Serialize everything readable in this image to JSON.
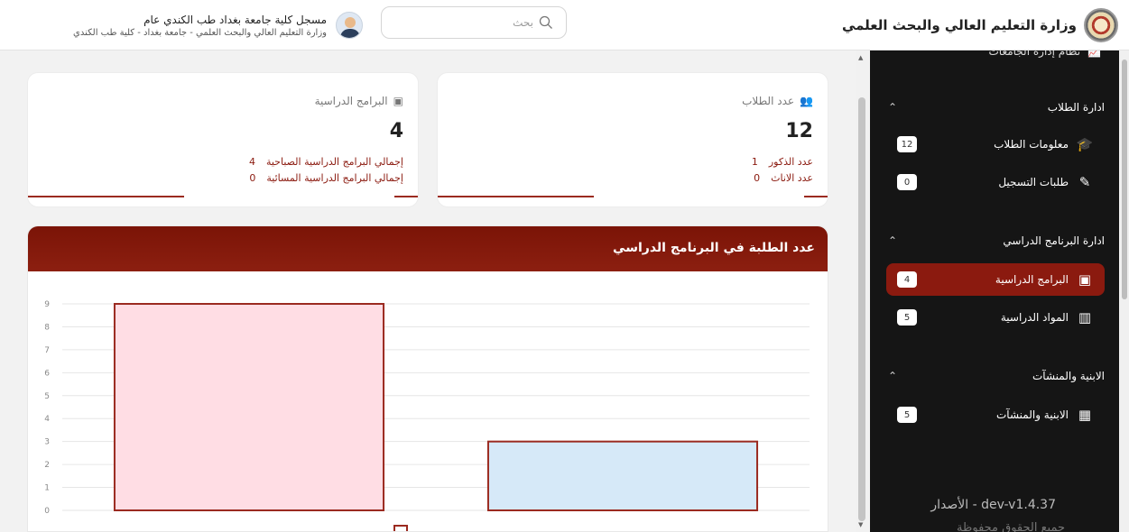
{
  "header": {
    "ministry_title": "وزارة التعليم العالي والبحث العلمي",
    "search_placeholder": "بحث",
    "user_name": "مسجل كلية جامعة بغداد طب الكندي عام",
    "user_subtitle": "وزارة التعليم العالي والبحث العلمي - جامعة بغداد - كلية طب الكندي"
  },
  "sidebar": {
    "top_item": "نظام إدارة الجامعات",
    "sections": [
      {
        "title": "ادارة الطلاب",
        "items": [
          {
            "label": "معلومات الطلاب",
            "badge": "12",
            "icon": "graduate-icon"
          },
          {
            "label": "طلبات التسجيل",
            "badge": "0",
            "icon": "edit-icon"
          }
        ]
      },
      {
        "title": "ادارة البرنامج الدراسي",
        "items": [
          {
            "label": "البرامج الدراسية",
            "badge": "4",
            "icon": "presentation-icon",
            "active": true
          },
          {
            "label": "المواد الدراسية",
            "badge": "5",
            "icon": "books-icon"
          }
        ]
      },
      {
        "title": "الابنية والمنشآت",
        "items": [
          {
            "label": "الابنية والمنشآت",
            "badge": "5",
            "icon": "building-icon"
          }
        ]
      }
    ],
    "version": "dev-v1.4.37 - الأصدار",
    "footer": "جميع الحقوق محفوظة"
  },
  "cards": {
    "students": {
      "title": "عدد الطلاب",
      "value": "12",
      "line1_label": "عدد الذكور",
      "line1_value": "1",
      "line2_label": "عدد الاناث",
      "line2_value": "0"
    },
    "programs": {
      "title": "البرامج الدراسية",
      "value": "4",
      "line1_label": "إجمالي البرامج الدراسية الصباحية",
      "line1_value": "4",
      "line2_label": "إجمالي البرامج الدراسية المسائية",
      "line2_value": "0"
    }
  },
  "chart_title": "عدد الطلبة في البرنامج الدراسي",
  "chart_data": {
    "type": "bar",
    "title": "عدد الطلبة في البرنامج الدراسي",
    "categories": [
      "",
      ""
    ],
    "values": [
      9,
      3
    ],
    "colors": [
      "#ffdde4",
      "#d6e9f8"
    ],
    "border_color": "#9b2a20",
    "ylim": [
      0,
      9
    ],
    "yticks": [
      0,
      1,
      2,
      3,
      4,
      5,
      6,
      7,
      8,
      9
    ],
    "grid": true,
    "legend_placement": "bottom"
  },
  "colors": {
    "accent": "#8b1a0f",
    "sidebar_bg": "#151515"
  }
}
